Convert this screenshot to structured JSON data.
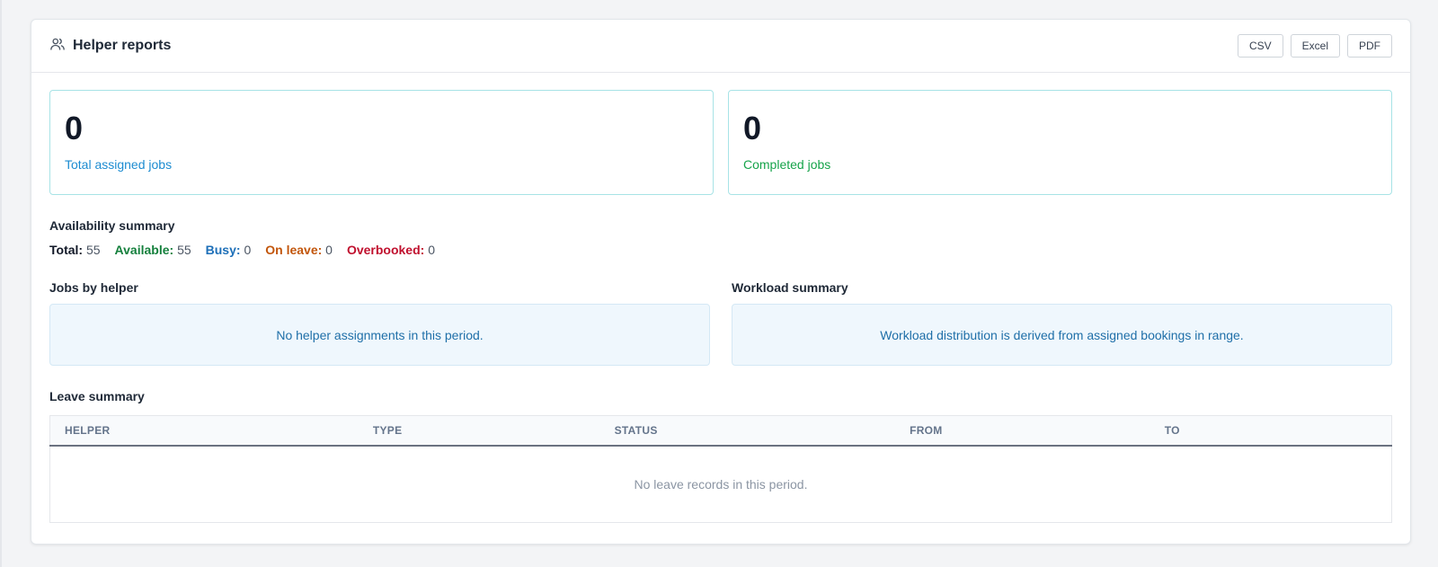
{
  "header": {
    "title": "Helper reports",
    "icon": "users-icon",
    "exports": [
      "CSV",
      "Excel",
      "PDF"
    ]
  },
  "stats": [
    {
      "value": "0",
      "label": "Total assigned jobs",
      "color": "#1d8cd1"
    },
    {
      "value": "0",
      "label": "Completed jobs",
      "color": "#16a34a"
    }
  ],
  "availability": {
    "title": "Availability summary",
    "items": [
      {
        "label": "Total:",
        "value": "55",
        "color": "#111827"
      },
      {
        "label": "Available:",
        "value": "55",
        "color": "#15803d"
      },
      {
        "label": "Busy:",
        "value": "0",
        "color": "#1d6fb8"
      },
      {
        "label": "On leave:",
        "value": "0",
        "color": "#c2560c"
      },
      {
        "label": "Overbooked:",
        "value": "0",
        "color": "#c0102e"
      }
    ]
  },
  "jobs_by_helper": {
    "title": "Jobs by helper",
    "message": "No helper assignments in this period."
  },
  "workload": {
    "title": "Workload summary",
    "message": "Workload distribution is derived from assigned bookings in range."
  },
  "leave": {
    "title": "Leave summary",
    "columns": [
      "HELPER",
      "TYPE",
      "STATUS",
      "FROM",
      "TO"
    ],
    "empty": "No leave records in this period."
  }
}
